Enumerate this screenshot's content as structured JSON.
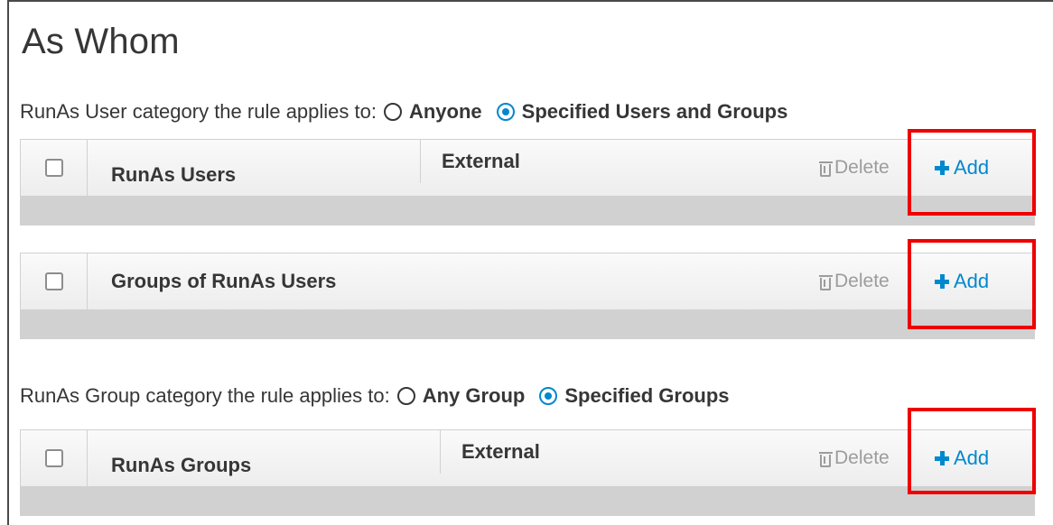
{
  "section": {
    "title": "As Whom"
  },
  "user_category": {
    "label": "RunAs User category the rule applies to:",
    "options": [
      {
        "label": "Anyone",
        "checked": false
      },
      {
        "label": "Specified Users and Groups",
        "checked": true
      }
    ]
  },
  "tables": {
    "runas_users": {
      "title": "RunAs Users",
      "external": "External",
      "delete_label": "Delete",
      "add_label": "Add"
    },
    "runas_user_groups": {
      "title": "Groups of RunAs Users",
      "delete_label": "Delete",
      "add_label": "Add"
    },
    "runas_groups": {
      "title": "RunAs Groups",
      "external": "External",
      "delete_label": "Delete",
      "add_label": "Add"
    }
  },
  "group_category": {
    "label": "RunAs Group category the rule applies to:",
    "options": [
      {
        "label": "Any Group",
        "checked": false
      },
      {
        "label": "Specified Groups",
        "checked": true
      }
    ]
  },
  "colors": {
    "accent": "#0088ce",
    "highlight": "#ee0000",
    "disabled_text": "#9c9c9c",
    "table_footer": "#d1d1d1"
  },
  "icons": {
    "delete": "trash-icon",
    "add": "plus-icon",
    "radio_selected": "radio-checked-icon",
    "radio_unselected": "radio-unchecked-icon"
  }
}
